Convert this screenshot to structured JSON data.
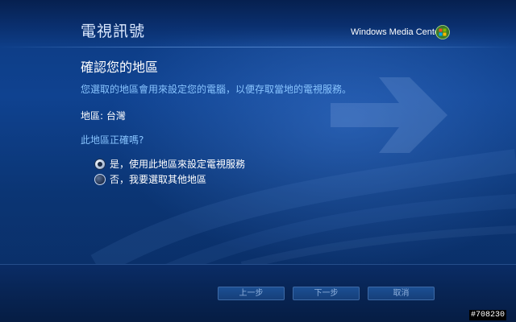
{
  "header": {
    "title": "電視訊號",
    "brand": "Windows Media Center",
    "brand_logo_icon": "windows-flag-icon"
  },
  "content": {
    "heading": "確認您的地區",
    "description": "您選取的地區會用來設定您的電腦，以便存取當地的電視服務。",
    "region_label": "地區: ",
    "region_value": "台灣",
    "question": "此地區正確嗎?"
  },
  "options": [
    {
      "label": "是，使用此地區來設定電視服務",
      "selected": true
    },
    {
      "label": "否，我要選取其他地區",
      "selected": false
    }
  ],
  "navigation": {
    "back": "上一步",
    "next": "下一步",
    "cancel": "取消"
  },
  "image_tag": "#708230",
  "colors": {
    "accent_text": "#88c4ff",
    "background": "#0f4290",
    "button_border": "#3d6aa6"
  }
}
